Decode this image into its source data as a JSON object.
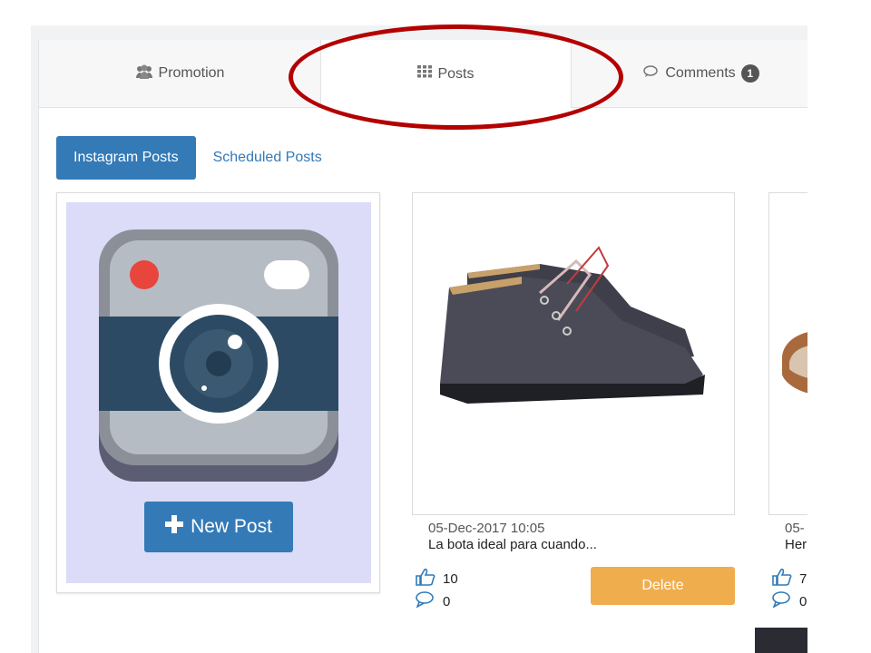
{
  "tabs": [
    {
      "label": "Promotion",
      "icon": "users-icon"
    },
    {
      "label": "Posts",
      "icon": "grid-icon",
      "active": true
    },
    {
      "label": "Comments",
      "icon": "comments-icon",
      "badge": "1"
    }
  ],
  "subtabs": [
    {
      "label": "Instagram Posts",
      "active": true
    },
    {
      "label": "Scheduled Posts"
    }
  ],
  "new_post": {
    "label": "New Post",
    "icon": "plus-icon"
  },
  "posts": [
    {
      "date": "05-Dec-2017 10:05",
      "caption": "La bota ideal para cuando...",
      "likes": "10",
      "comments": "0",
      "delete_label": "Delete"
    },
    {
      "date": "05-",
      "caption": "Her",
      "likes": "7",
      "comments": "0"
    }
  ],
  "colors": {
    "primary": "#337ab7",
    "warning": "#f0ad4e",
    "highlight_circle": "#b30000"
  }
}
